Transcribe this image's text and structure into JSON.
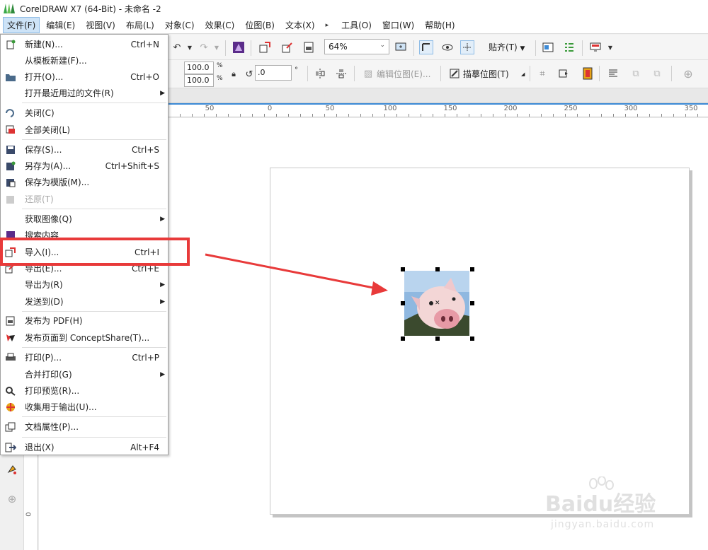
{
  "window": {
    "title": "CorelDRAW X7 (64-Bit) - 未命名 -2"
  },
  "menubar": {
    "items": [
      "文件(F)",
      "编辑(E)",
      "视图(V)",
      "布局(L)",
      "对象(C)",
      "效果(C)",
      "位图(B)",
      "文本(X)",
      "工具(O)",
      "窗口(W)",
      "帮助(H)"
    ],
    "overflow_glyph": "▸"
  },
  "toolbar": {
    "zoom_value": "64%",
    "snap_label": "贴齐(T)",
    "width_percent": "100.0",
    "height_percent": "100.0",
    "percent_unit": "%",
    "rotation_value": ".0",
    "degree_unit": "°",
    "edit_bitmap_label": "编辑位图(E)...",
    "trace_bitmap_label": "描摹位图(T)"
  },
  "ruler": {
    "labels": [
      "50",
      "0",
      "50",
      "100",
      "150",
      "200",
      "250",
      "300",
      "350"
    ],
    "vertical_label": "0"
  },
  "file_menu": {
    "items": [
      {
        "label": "新建(N)...",
        "shortcut": "Ctrl+N",
        "icon": "new-doc-icon"
      },
      {
        "label": "从模板新建(F)...",
        "shortcut": "",
        "icon": ""
      },
      {
        "label": "打开(O)...",
        "shortcut": "Ctrl+O",
        "icon": "open-folder-icon"
      },
      {
        "label": "打开最近用过的文件(R)",
        "shortcut": "",
        "submenu": true,
        "icon": ""
      },
      {
        "label": "关闭(C)",
        "shortcut": "",
        "icon": "close-doc-icon"
      },
      {
        "label": "全部关闭(L)",
        "shortcut": "",
        "icon": "close-all-icon"
      },
      {
        "label": "保存(S)...",
        "shortcut": "Ctrl+S",
        "icon": "save-icon"
      },
      {
        "label": "另存为(A)...",
        "shortcut": "Ctrl+Shift+S",
        "icon": "save-as-icon"
      },
      {
        "label": "保存为模版(M)...",
        "shortcut": "",
        "icon": "save-template-icon"
      },
      {
        "label": "还原(T)",
        "shortcut": "",
        "disabled": true,
        "icon": "revert-icon"
      },
      {
        "label": "获取图像(Q)",
        "shortcut": "",
        "submenu": true,
        "icon": ""
      },
      {
        "label": "搜索内容",
        "shortcut": "",
        "icon": "search-content-icon"
      },
      {
        "label": "导入(I)...",
        "shortcut": "Ctrl+I",
        "icon": "import-icon"
      },
      {
        "label": "导出(E)...",
        "shortcut": "Ctrl+E",
        "icon": "export-icon"
      },
      {
        "label": "导出为(R)",
        "shortcut": "",
        "submenu": true,
        "icon": ""
      },
      {
        "label": "发送到(D)",
        "shortcut": "",
        "submenu": true,
        "icon": ""
      },
      {
        "label": "发布为 PDF(H)",
        "shortcut": "",
        "icon": "pdf-icon"
      },
      {
        "label": "发布页面到 ConceptShare(T)...",
        "shortcut": "",
        "icon": "conceptshare-icon"
      },
      {
        "label": "打印(P)...",
        "shortcut": "Ctrl+P",
        "icon": "print-icon"
      },
      {
        "label": "合并打印(G)",
        "shortcut": "",
        "submenu": true,
        "icon": ""
      },
      {
        "label": "打印预览(R)...",
        "shortcut": "",
        "icon": "print-preview-icon"
      },
      {
        "label": "收集用于输出(U)...",
        "shortcut": "",
        "icon": "collect-output-icon"
      },
      {
        "label": "文档属性(P)...",
        "shortcut": "",
        "icon": "doc-properties-icon"
      },
      {
        "label": "退出(X)",
        "shortcut": "Alt+F4",
        "icon": "exit-icon"
      }
    ]
  },
  "watermark": {
    "brand": "Baidu经验",
    "url": "jingyan.baidu.com"
  },
  "colors": {
    "highlight": "#e83a3a",
    "menu_active": "#cde3f7",
    "ruler_accent": "#3c8ad6"
  }
}
